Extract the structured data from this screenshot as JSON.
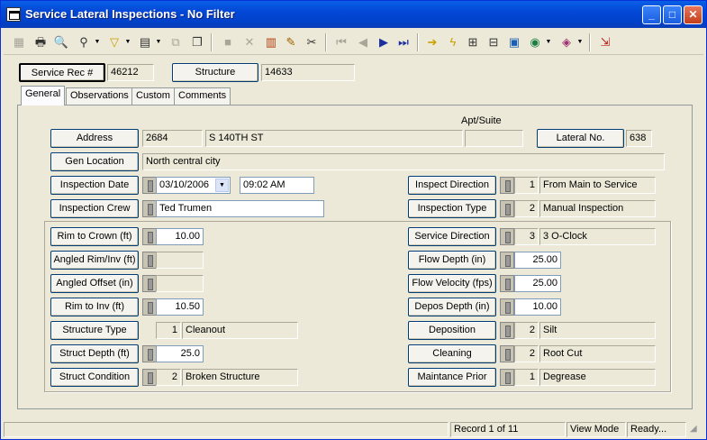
{
  "window": {
    "title": "Service Lateral Inspections - No Filter"
  },
  "titlebar_buttons": {
    "minimize": "_",
    "maximize": "□",
    "close": "✕"
  },
  "header": {
    "service_rec_label": "Service Rec #",
    "service_rec_value": "46212",
    "structure_label": "Structure",
    "structure_value": "14633"
  },
  "tabs": [
    {
      "label": "General",
      "active": true
    },
    {
      "label": "Observations"
    },
    {
      "label": "Custom"
    },
    {
      "label": "Comments"
    }
  ],
  "general": {
    "apt_suite_label": "Apt/Suite",
    "address_label": "Address",
    "address_number": "2684",
    "address_street": "S 140TH ST",
    "apt_suite_value": "",
    "lateral_no_label": "Lateral No.",
    "lateral_no_value": "638",
    "gen_location_label": "Gen Location",
    "gen_location_value": "North central city",
    "inspection_date_label": "Inspection Date",
    "inspection_date_value": "03/10/2006",
    "inspection_time_value": "09:02 AM",
    "inspection_crew_label": "Inspection Crew",
    "inspection_crew_value": "Ted Trumen",
    "inspect_direction_label": "Inspect Direction",
    "inspect_direction_code": "1",
    "inspect_direction_value": "From Main to Service",
    "inspection_type_label": "Inspection Type",
    "inspection_type_code": "2",
    "inspection_type_value": "Manual Inspection"
  },
  "measurements": {
    "rim_to_crown_label": "Rim to Crown (ft)",
    "rim_to_crown_value": "10.00",
    "angled_rim_label": "Angled Rim/Inv (ft)",
    "angled_rim_value": "",
    "angled_offset_label": "Angled Offset (in)",
    "angled_offset_value": "",
    "rim_to_inv_label": "Rim to Inv (ft)",
    "rim_to_inv_value": "10.50",
    "structure_type_label": "Structure Type",
    "structure_type_code": "1",
    "structure_type_value": "Cleanout",
    "struct_depth_label": "Struct Depth (ft)",
    "struct_depth_value": "25.0",
    "struct_condition_label": "Struct Condition",
    "struct_condition_code": "2",
    "struct_condition_value": "Broken Structure",
    "service_direction_label": "Service Direction",
    "service_direction_code": "3",
    "service_direction_value": "3 O-Clock",
    "flow_depth_label": "Flow Depth (in)",
    "flow_depth_value": "25.00",
    "flow_velocity_label": "Flow Velocity (fps)",
    "flow_velocity_value": "25.00",
    "depos_depth_label": "Depos Depth (in)",
    "depos_depth_value": "10.00",
    "deposition_label": "Deposition",
    "deposition_code": "2",
    "deposition_value": "Silt",
    "cleaning_label": "Cleaning",
    "cleaning_code": "2",
    "cleaning_value": "Root Cut",
    "maintance_prior_label": "Maintance Prior",
    "maintance_prior_code": "1",
    "maintance_prior_value": "Degrease"
  },
  "statusbar": {
    "record": "Record 1 of 11",
    "mode": "View Mode",
    "state": "Ready..."
  },
  "toolbar_icons": [
    "grid-icon",
    "print-icon",
    "preview-icon",
    "binoculars-icon",
    "filter-icon",
    "form-icon",
    "copy-icon",
    "duplicate-icon",
    "save-icon",
    "delete-icon",
    "books-icon",
    "pencil-icon",
    "scissors-icon",
    "first-record-icon",
    "prev-record-icon",
    "next-record-icon",
    "last-record-icon",
    "arrow-right-icon",
    "lightning-icon",
    "tree-icon",
    "hierarchy-icon",
    "map-icon",
    "globe-icon",
    "book-icon",
    "exit-icon"
  ]
}
